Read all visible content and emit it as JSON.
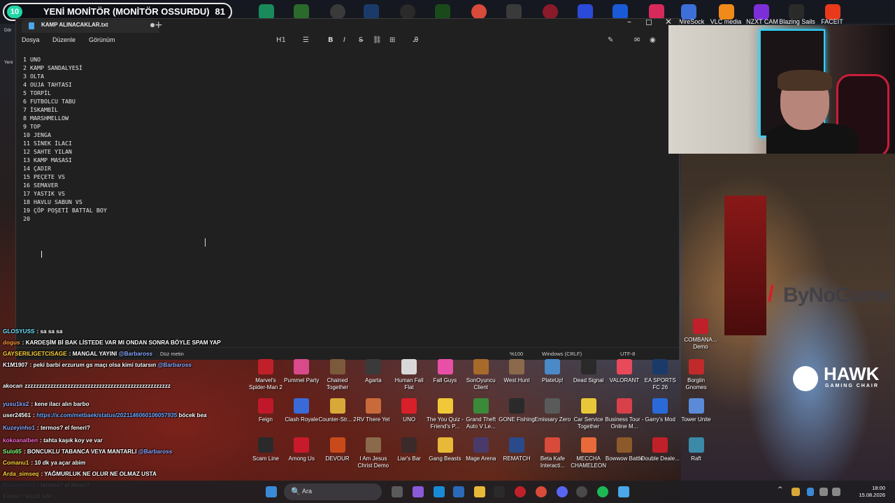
{
  "stream": {
    "level": "10",
    "title": "YENİ MONİTÖR (MONİTÖR OSSURDU)",
    "count": "81"
  },
  "top_apps": [
    {
      "label": "WireSock",
      "color": "#3c6fd8"
    },
    {
      "label": "VLC media",
      "color": "#f08a18"
    },
    {
      "label": "NZXT CAM",
      "color": "#7c2ed8"
    },
    {
      "label": "Blazing Sails",
      "color": "#2a2a2a"
    },
    {
      "label": "FACEIT",
      "color": "#e83a1a"
    }
  ],
  "notepad": {
    "tab_title": "KAMP ALINACAKLAR.txt",
    "new_tab": "+",
    "window_controls": {
      "minimize": "–",
      "maximize": "◻",
      "close": "✕"
    },
    "menu": {
      "file": "Dosya",
      "edit": "Düzenle",
      "view": "Görünüm"
    },
    "toolbar": {
      "heading": "H1",
      "bold": "B",
      "italic": "I",
      "strike": "S",
      "list": "☰",
      "link": "⛓",
      "table": "⊞",
      "clear": "Ꭿ"
    },
    "lines": [
      "1 UNO",
      "2 KAMP SANDALYESİ",
      "3 OLTA",
      "4 OUJA TAHTASI",
      "5 TORPİL",
      "6 FUTBOLCU TABU",
      "7 İSKAMBİL",
      "8 MARSHMELLOW",
      "9 TOP",
      "10 JENGA",
      "11 SİNEK İLACI",
      "12 SAHTE YILAN",
      "13 KAMP MASASI",
      "14 ÇADIR",
      "15 PEÇETE VS",
      "16 SEMAVER",
      "17 YASTIK VS",
      "18 HAVLU SABUN VS",
      "19 ÇÖP POŞETİ BATTAL BOY",
      "20 "
    ],
    "status": {
      "zoom": "%100",
      "line_ending": "Windows (CRLF)",
      "encoding": "UTF-8",
      "format": "Düz metin"
    }
  },
  "chat": [
    {
      "user": "GLOSYUSS",
      "user_color": "#6fe3ff",
      "text": ": sa sa sa"
    },
    {
      "user": "dogus",
      "user_color": "#ff9a3a",
      "text": ": KARDEŞİM Bİ BAK LİSTEDE VAR MI ONDAN SONRA BÖYLE SPAM YAP"
    },
    {
      "user": "GAYSERILIGETCISAGE",
      "user_color": "#ffd23a",
      "text": ": MANGAL YAYINI",
      "mention": "@Barbaross"
    },
    {
      "user": "K1M1907",
      "user_color": "#ffffff",
      "text": ": peki barbi erzurum gs maçı olsa kimi tutarsın",
      "mention": "@Barbaross"
    },
    {
      "user": "akocan",
      "user_color": "#ffffff",
      "text": "zzzzzzzzzzzzzzzzzzzzzzzzzzzzzzzzzzzzzzzzzzzzzzzzzzz"
    },
    {
      "user": "yusu1ks2",
      "user_color": "#8aa9ff",
      "text": ": kene ilacı alın barbo"
    },
    {
      "user": "user24561",
      "user_color": "#ffffff",
      "text": ":",
      "link": "https://x.com/metbaek/status/2021146060106057935",
      "after": "böcek bea"
    },
    {
      "user": "Kuzeyinho1",
      "user_color": "#8aa9ff",
      "text": ": termos? el feneri?"
    },
    {
      "user": "kokoanalben",
      "user_color": "#ff6ad5",
      "text": ": tahta kaşık koy ve var"
    },
    {
      "user": "Sulo65",
      "user_color": "#7dff7d",
      "text": ": BONCUKLU TABANCA VEYA MANTARLI",
      "mention": "@Barbaross"
    },
    {
      "user": "Comanu1",
      "user_color": "#ffd23a",
      "text": ": 10 dk ya açar abim"
    },
    {
      "user": "Arda_simseq",
      "user_color": "#ffd23a",
      "text": ": YAĞMURLUK NE OLUR NE OLMAZ USTA"
    },
    {
      "user": "Kuzeyinho1",
      "user_color": "#8aa9ff",
      "text": ": termos? el feneri?"
    },
    {
      "user": "Eeksu",
      "user_color": "#ffffff",
      "text": ": küçül lale"
    }
  ],
  "desktop_icons": [
    {
      "label": "Marvel's Spider-Man 2",
      "color": "#c0202a"
    },
    {
      "label": "Pummel Party",
      "color": "#d84a8a"
    },
    {
      "label": "Chained Together",
      "color": "#7a5a3a"
    },
    {
      "label": "Agarta",
      "color": "#3a3a3a"
    },
    {
      "label": "Human Fall Flat",
      "color": "#d8d8d8"
    },
    {
      "label": "Fall Guys",
      "color": "#e850a8"
    },
    {
      "label": "SonOyuncu Client",
      "color": "#a86a2a"
    },
    {
      "label": "West Hunt",
      "color": "#8a6a4a"
    },
    {
      "label": "PlateUp!",
      "color": "#4a8ac8"
    },
    {
      "label": "Dead Signal",
      "color": "#2a2a2a"
    },
    {
      "label": "VALORANT",
      "color": "#e84a5a"
    },
    {
      "label": "EA SPORTS FC 26",
      "color": "#1a3a6a"
    },
    {
      "label": "Borgiin Gnomes",
      "color": "#c02a2a"
    },
    {
      "label": "Feign",
      "color": "#c0182a"
    },
    {
      "label": "Clash Royale",
      "color": "#3a6ad8"
    },
    {
      "label": "Counter-Str... 2",
      "color": "#d8a838"
    },
    {
      "label": "RV There Yet",
      "color": "#c86a3a"
    },
    {
      "label": "UNO",
      "color": "#d8202a"
    },
    {
      "label": "The You Quiz - Friend's P...",
      "color": "#f0c838"
    },
    {
      "label": "Grand Theft Auto V Le...",
      "color": "#3a8a3a"
    },
    {
      "label": "GONE Fishing",
      "color": "#2a2a2a"
    },
    {
      "label": "Emissary Zero",
      "color": "#5a5a5a"
    },
    {
      "label": "Car Service Together",
      "color": "#e8c838"
    },
    {
      "label": "Business Tour - Online M...",
      "color": "#d8404a"
    },
    {
      "label": "Garry's Mod",
      "color": "#2a6ad8"
    },
    {
      "label": "Tower Unite",
      "color": "#5a8ad8"
    },
    {
      "label": "Scam Line",
      "color": "#2a2a2a"
    },
    {
      "label": "Among Us",
      "color": "#c81a2a"
    },
    {
      "label": "DEVOUR",
      "color": "#c84a1a"
    },
    {
      "label": "I Am Jesus Christ Demo",
      "color": "#8a6a4a"
    },
    {
      "label": "Liar's Bar",
      "color": "#3a2a2a"
    },
    {
      "label": "Gang Beasts",
      "color": "#e8b838"
    },
    {
      "label": "Mage Arena",
      "color": "#4a3a6a"
    },
    {
      "label": "REMATCH",
      "color": "#2a4a8a"
    },
    {
      "label": "Beta Kafe Interacti...",
      "color": "#d84a3a"
    },
    {
      "label": "MECCHA CHAMELEON",
      "color": "#e86a3a"
    },
    {
      "label": "Bowwow Battle",
      "color": "#8a5a2a"
    },
    {
      "label": "Double Deale...",
      "color": "#c0202a"
    },
    {
      "label": "Raft",
      "color": "#3a8aa8"
    }
  ],
  "right_icons": [
    {
      "label": "COMBANA... Demo",
      "color": "#c0202a"
    }
  ],
  "art": {
    "brand": "ByNoGame",
    "slash": "/",
    "hawk": "HAWK",
    "hawk_sub": "GAMING CHAIR"
  },
  "taskbar": {
    "search_icon": "🔍",
    "search_placeholder": "Ara",
    "time": "18:00",
    "date": "15.08.2026"
  }
}
